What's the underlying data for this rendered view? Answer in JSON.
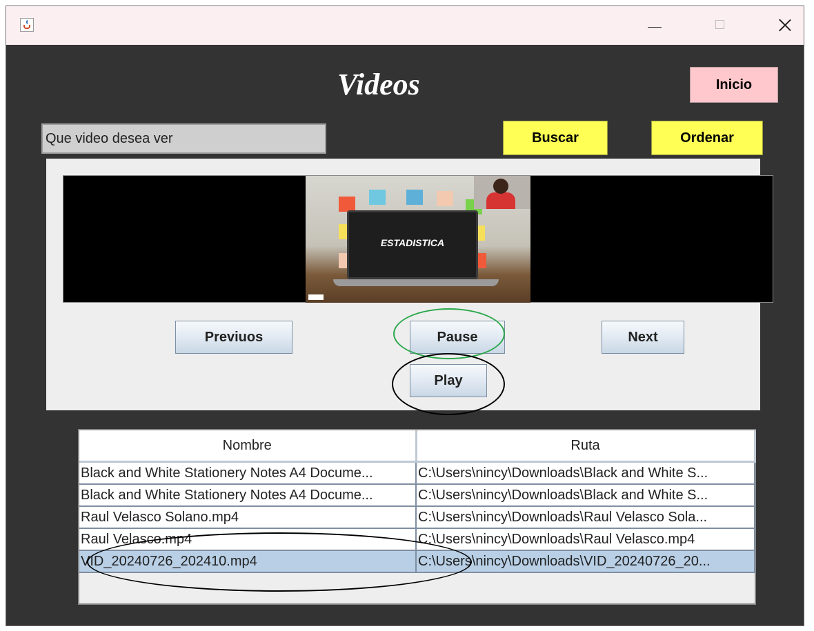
{
  "window": {
    "title": "",
    "app_icon": "java-cup-icon",
    "controls": {
      "minimize": "—",
      "close": "✕"
    }
  },
  "header": {
    "title": "Videos",
    "home_button": "Inicio"
  },
  "search": {
    "value": "Que video desea ver",
    "search_button": "Buscar",
    "sort_button": "Ordenar"
  },
  "player": {
    "thumbnail_text": "ESTADISTICA",
    "buttons": {
      "previous": "Previuos",
      "pause": "Pause",
      "next": "Next",
      "play": "Play"
    }
  },
  "table": {
    "columns": [
      "Nombre",
      "Ruta"
    ],
    "rows": [
      [
        "Black and White Stationery Notes A4 Docume...",
        "C:\\Users\\nincy\\Downloads\\Black and White S..."
      ],
      [
        "Black and White Stationery Notes A4 Docume...",
        "C:\\Users\\nincy\\Downloads\\Black and White S..."
      ],
      [
        "Raul Velasco Solano.mp4",
        "C:\\Users\\nincy\\Downloads\\Raul Velasco Sola..."
      ],
      [
        "Raul Velasco.mp4",
        "C:\\Users\\nincy\\Downloads\\Raul Velasco.mp4"
      ],
      [
        "VID_20240726_202410.mp4",
        "C:\\Users\\nincy\\Downloads\\VID_20240726_20..."
      ]
    ],
    "selected_row": 4
  },
  "colors": {
    "window_bg": "#333333",
    "titlebar_bg": "#fbeff2",
    "home_button": "#ffc8cc",
    "action_buttons": "#ffff55",
    "selection": "#b8cfe5",
    "annotation_green": "#2aa84a",
    "annotation_black": "#000000"
  }
}
